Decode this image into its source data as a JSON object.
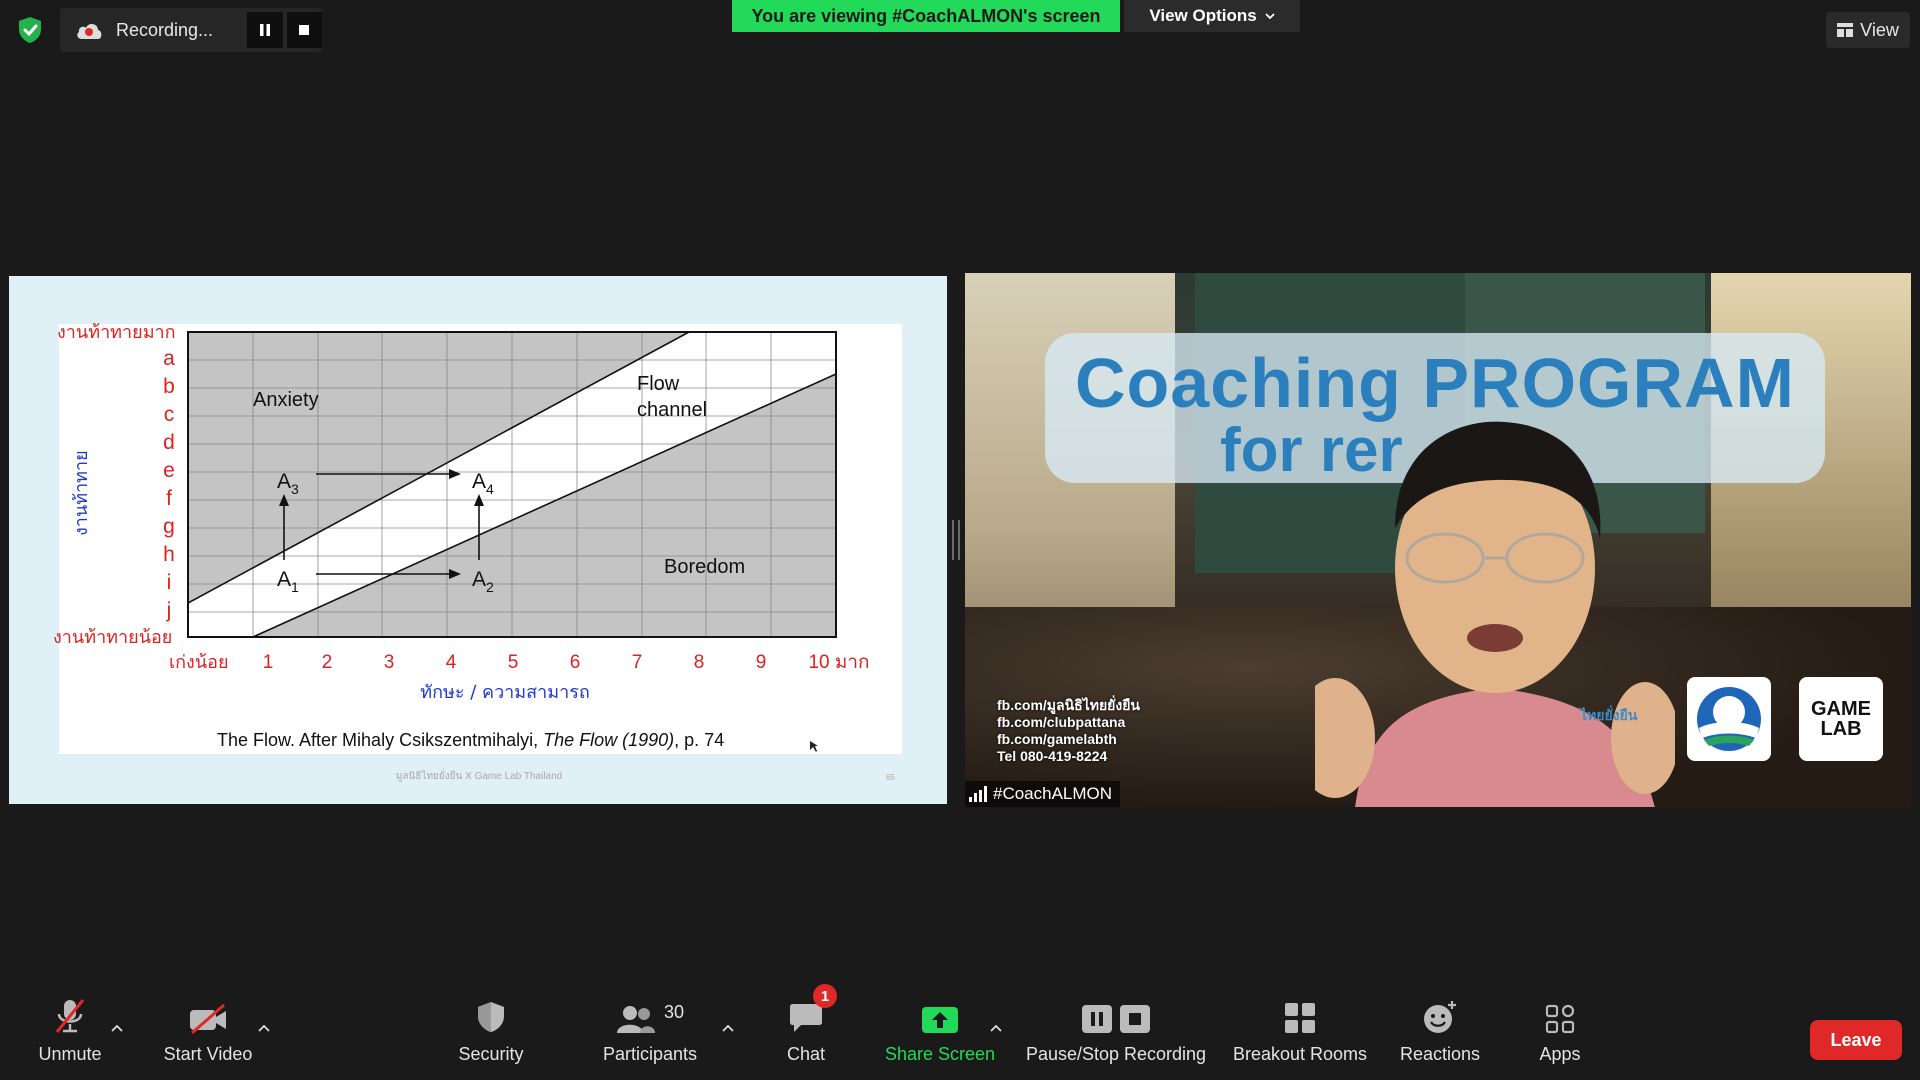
{
  "top": {
    "recording_label": "Recording...",
    "viewing_banner": "You are viewing #CoachALMON's screen",
    "view_options_label": "View Options",
    "view_label": "View"
  },
  "slide": {
    "y_top_label": "งานท้าทายมาก",
    "y_bottom_label": "งานท้าทายน้อย",
    "y_axis_title": "งานท้าทาย",
    "y_letters": [
      "a",
      "b",
      "c",
      "d",
      "e",
      "f",
      "g",
      "h",
      "i",
      "j"
    ],
    "x_start_label": "เก่งน้อย",
    "x_numbers": [
      "1",
      "2",
      "3",
      "4",
      "5",
      "6",
      "7",
      "8",
      "9",
      "10 มาก"
    ],
    "x_axis_title": "ทักษะ / ความสามารถ",
    "region_anxiety": "Anxiety",
    "region_flow_1": "Flow",
    "region_flow_2": "channel",
    "region_boredom": "Boredom",
    "points": [
      "A",
      "A",
      "A",
      "A"
    ],
    "point_subs": [
      "3",
      "4",
      "1",
      "2"
    ],
    "caption_prefix": "The Flow.  After Mihaly Csikszentmihalyi, ",
    "caption_italic": "The Flow (1990)",
    "caption_suffix": ", p. 74",
    "watermark": "มูลนิธิไทยยั่งยืน X Game Lab Thailand",
    "page_mark": "65"
  },
  "speaker": {
    "title_line1": "Coaching PROGRAM",
    "title_line2": "for   rer",
    "contacts": [
      "fb.com/มูลนิธิไทยยั่งยืน",
      "fb.com/clubpattana",
      "fb.com/gamelabth",
      "Tel 080-419-8224"
    ],
    "thai_tag": "ไทยยั่งยืน",
    "game_logo_1": "GAME",
    "game_logo_2": "LAB",
    "name": "#CoachALMON"
  },
  "toolbar": {
    "unmute": "Unmute",
    "start_video": "Start Video",
    "security": "Security",
    "participants": "Participants",
    "participants_count": "30",
    "chat": "Chat",
    "chat_badge": "1",
    "share_screen": "Share Screen",
    "pause_stop": "Pause/Stop Recording",
    "breakout": "Breakout Rooms",
    "reactions": "Reactions",
    "apps": "Apps",
    "leave": "Leave"
  },
  "colors": {
    "banner_green": "#23d959",
    "share_green": "#23d959",
    "leave_red": "#e02828",
    "slide_red": "#e02020",
    "slide_blue": "#2038d0"
  }
}
